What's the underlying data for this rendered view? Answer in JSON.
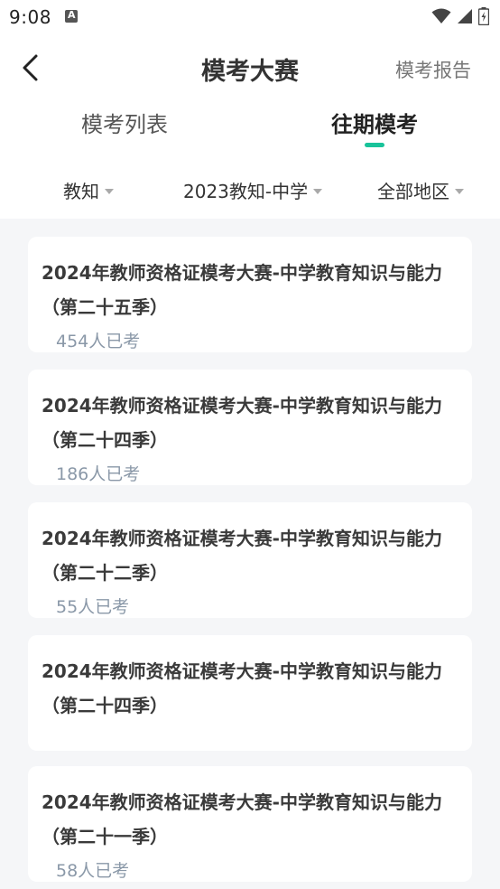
{
  "status_bar": {
    "time": "9:08",
    "app_icon": "a-notification-icon",
    "icons": [
      "wifi-icon",
      "signal-icon",
      "battery-icon"
    ]
  },
  "header": {
    "back_icon": "chevron-left-icon",
    "title": "模考大赛",
    "report_label": "模考报告"
  },
  "tabs": [
    {
      "label": "模考列表",
      "active": false
    },
    {
      "label": "往期模考",
      "active": true
    }
  ],
  "filters": [
    {
      "label": "教知",
      "icon": "caret-down-icon"
    },
    {
      "label": "2023教知-中学",
      "icon": "caret-down-icon"
    },
    {
      "label": "全部地区",
      "icon": "caret-down-icon"
    }
  ],
  "exams": [
    {
      "title": "2024年教师资格证模考大赛-中学教育知识与能力（第二十五季）",
      "count": "454人已考"
    },
    {
      "title": "2024年教师资格证模考大赛-中学教育知识与能力（第二十四季）",
      "count": "186人已考"
    },
    {
      "title": "2024年教师资格证模考大赛-中学教育知识与能力（第二十二季）",
      "count": "55人已考"
    },
    {
      "title": "2024年教师资格证模考大赛-中学教育知识与能力（第二十四季）",
      "count": ""
    },
    {
      "title": "2024年教师资格证模考大赛-中学教育知识与能力（第二十一季）",
      "count": "58人已考"
    }
  ],
  "colors": {
    "accent": "#19c39a",
    "background": "#f5f6f8",
    "count_text": "#8a98a8"
  }
}
